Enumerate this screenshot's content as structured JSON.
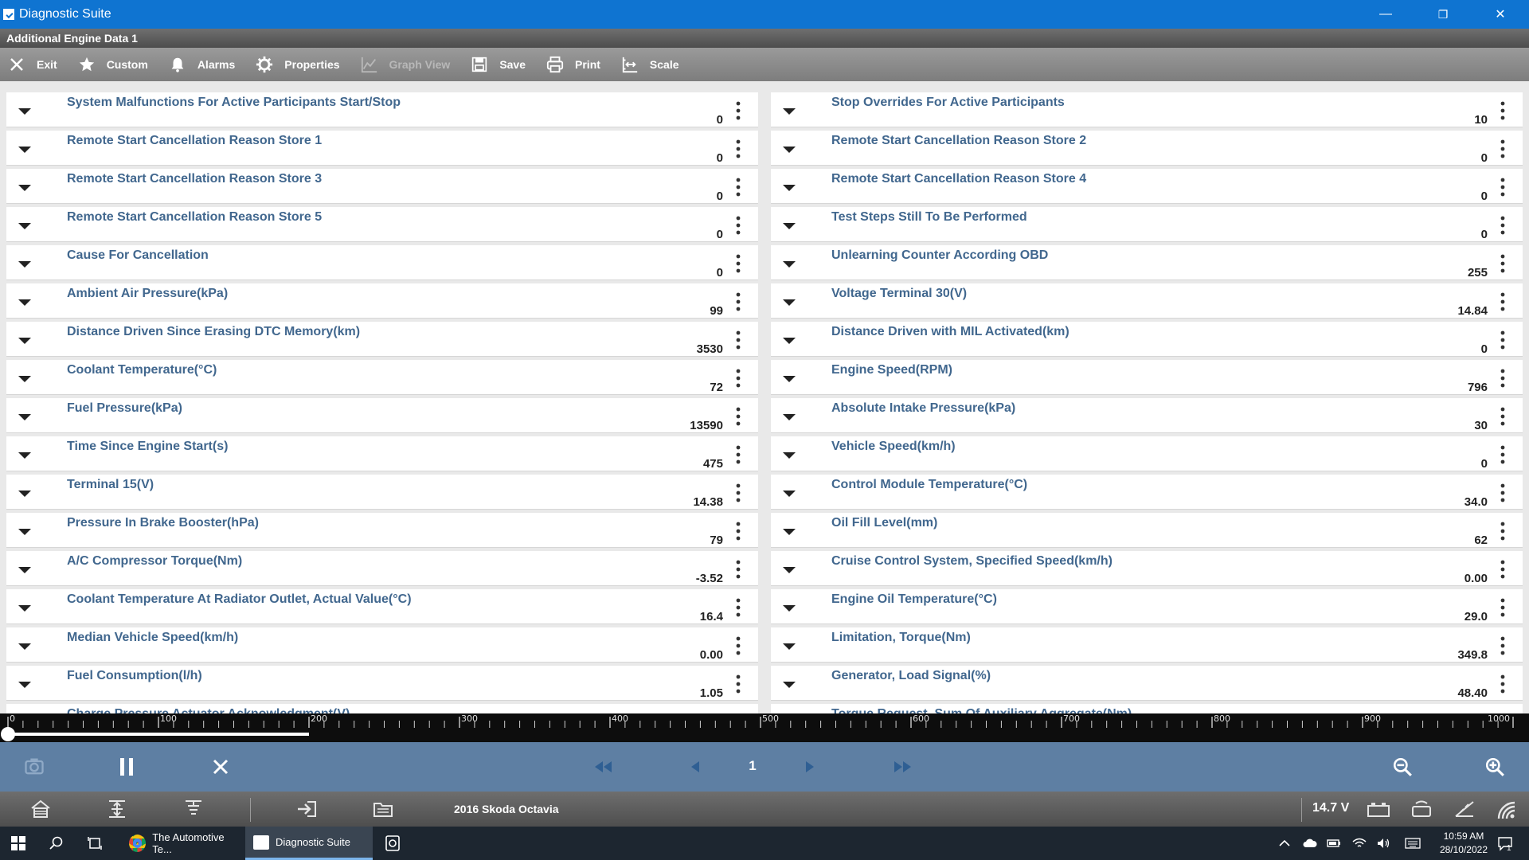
{
  "window": {
    "title": "Diagnostic Suite",
    "minimize": "—",
    "restore": "❐",
    "close": "✕"
  },
  "subtitle": "Additional Engine Data 1",
  "toolbar": {
    "exit": "Exit",
    "custom": "Custom",
    "alarms": "Alarms",
    "properties": "Properties",
    "graph_view": "Graph View",
    "save": "Save",
    "print": "Print",
    "scale": "Scale"
  },
  "left_rows": [
    {
      "label": "System Malfunctions For Active Participants Start/Stop",
      "value": "0"
    },
    {
      "label": "Remote Start Cancellation Reason Store 1",
      "value": "0"
    },
    {
      "label": "Remote Start Cancellation Reason Store 3",
      "value": "0"
    },
    {
      "label": "Remote Start Cancellation Reason Store 5",
      "value": "0"
    },
    {
      "label": "Cause For Cancellation",
      "value": "0"
    },
    {
      "label": "Ambient Air Pressure(kPa)",
      "value": "99"
    },
    {
      "label": "Distance Driven Since Erasing DTC Memory(km)",
      "value": "3530"
    },
    {
      "label": "Coolant Temperature(°C)",
      "value": "72"
    },
    {
      "label": "Fuel Pressure(kPa)",
      "value": "13590"
    },
    {
      "label": "Time Since Engine Start(s)",
      "value": "475"
    },
    {
      "label": "Terminal 15(V)",
      "value": "14.38"
    },
    {
      "label": "Pressure In Brake Booster(hPa)",
      "value": "79"
    },
    {
      "label": "A/C Compressor Torque(Nm)",
      "value": "-3.52"
    },
    {
      "label": "Coolant Temperature At Radiator Outlet, Actual Value(°C)",
      "value": "16.4"
    },
    {
      "label": "Median Vehicle Speed(km/h)",
      "value": "0.00"
    },
    {
      "label": "Fuel Consumption(l/h)",
      "value": "1.05"
    }
  ],
  "left_partial": "Charge Pressure Actuator Acknowledgment(V)",
  "right_rows": [
    {
      "label": "Stop Overrides For Active Participants",
      "value": "10"
    },
    {
      "label": "Remote Start Cancellation Reason Store 2",
      "value": "0"
    },
    {
      "label": "Remote Start Cancellation Reason Store 4",
      "value": "0"
    },
    {
      "label": "Test Steps Still To Be Performed",
      "value": "0"
    },
    {
      "label": "Unlearning Counter According OBD",
      "value": "255"
    },
    {
      "label": "Voltage Terminal 30(V)",
      "value": "14.84"
    },
    {
      "label": "Distance Driven with MIL Activated(km)",
      "value": "0"
    },
    {
      "label": "Engine Speed(RPM)",
      "value": "796"
    },
    {
      "label": "Absolute Intake Pressure(kPa)",
      "value": "30"
    },
    {
      "label": "Vehicle Speed(km/h)",
      "value": "0"
    },
    {
      "label": "Control Module Temperature(°C)",
      "value": "34.0"
    },
    {
      "label": "Oil Fill Level(mm)",
      "value": "62"
    },
    {
      "label": "Cruise Control System, Specified Speed(km/h)",
      "value": "0.00"
    },
    {
      "label": "Engine Oil Temperature(°C)",
      "value": "29.0"
    },
    {
      "label": "Limitation, Torque(Nm)",
      "value": "349.8"
    },
    {
      "label": "Generator, Load Signal(%)",
      "value": "48.40"
    }
  ],
  "right_partial": "Torque Request, Sum Of Auxiliary Aggregate(Nm)",
  "ruler": {
    "ticks": [
      "0",
      "100",
      "200",
      "300",
      "400",
      "500",
      "600",
      "700",
      "800",
      "900",
      "1000"
    ],
    "buffered_fraction": 0.2
  },
  "playback": {
    "page": "1"
  },
  "statusbar": {
    "vehicle": "2016 Skoda Octavia",
    "voltage": "14.7 V"
  },
  "taskbar": {
    "app1": "The Automotive Te...",
    "app2": "Diagnostic Suite",
    "time": "10:59 AM",
    "date": "28/10/2022",
    "notif": "1"
  }
}
